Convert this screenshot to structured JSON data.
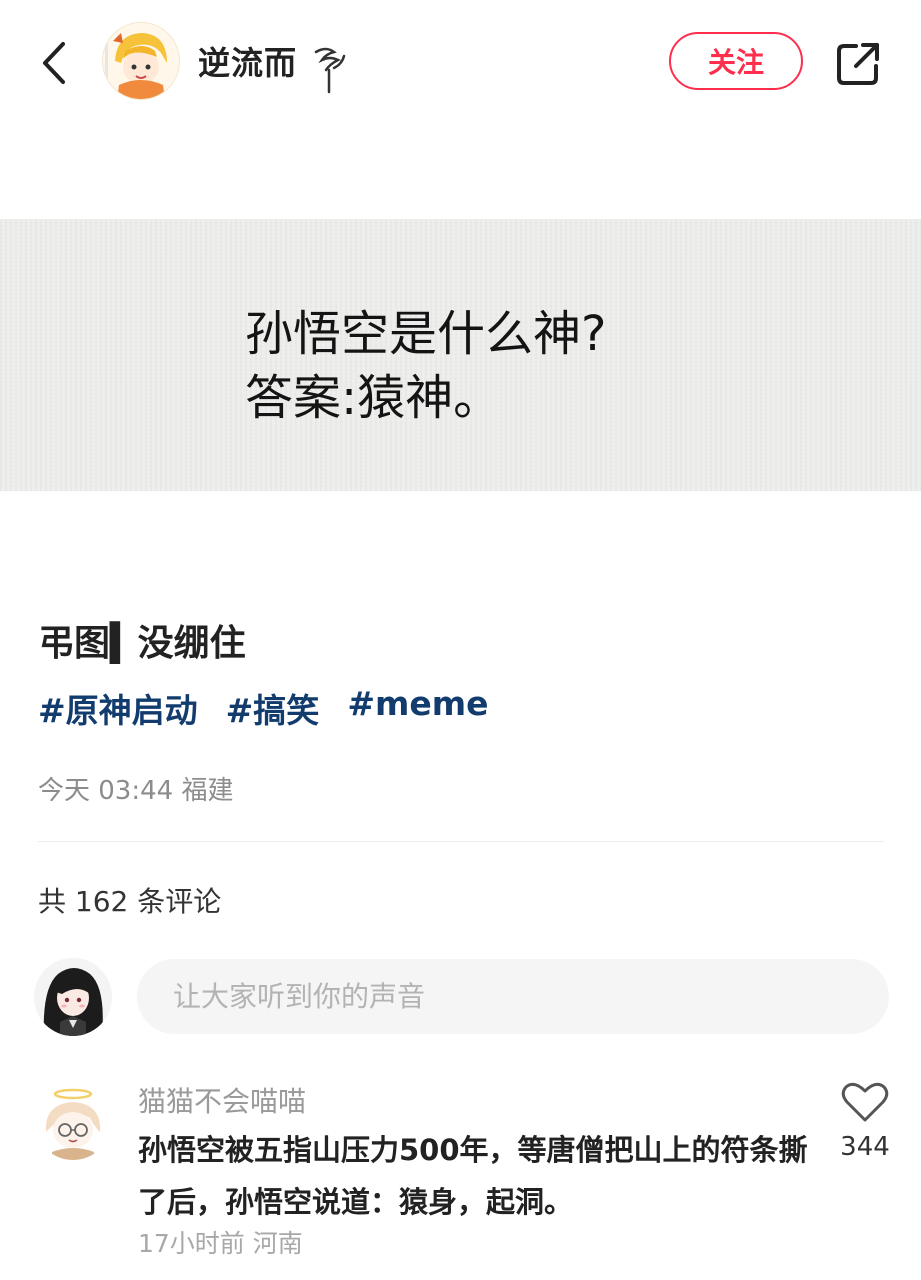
{
  "header": {
    "username": "逆流而",
    "follow_label": "关注"
  },
  "post": {
    "image_text": {
      "line1": "孙悟空是什么神?",
      "line2": "答案:猿神。"
    },
    "title": "弔图▍没绷住",
    "tags": [
      "#原神启动",
      "#搞笑",
      "#meme"
    ],
    "meta": "今天 03:44 福建"
  },
  "comments": {
    "count_label": "共 162 条评论",
    "input_placeholder": "让大家听到你的声音",
    "items": [
      {
        "user": "猫猫不会喵喵",
        "text": "孙悟空被五指山压力500年，等唐僧把山上的符条撕了后，孙悟空说道：猿身，起洞。",
        "meta": "17小时前 河南",
        "likes": "344"
      }
    ]
  },
  "icons": {
    "back": "chevron-left-icon",
    "share": "share-icon",
    "like": "heart-icon"
  },
  "colors": {
    "accent": "#ff2e4d",
    "tag": "#123b6e"
  }
}
